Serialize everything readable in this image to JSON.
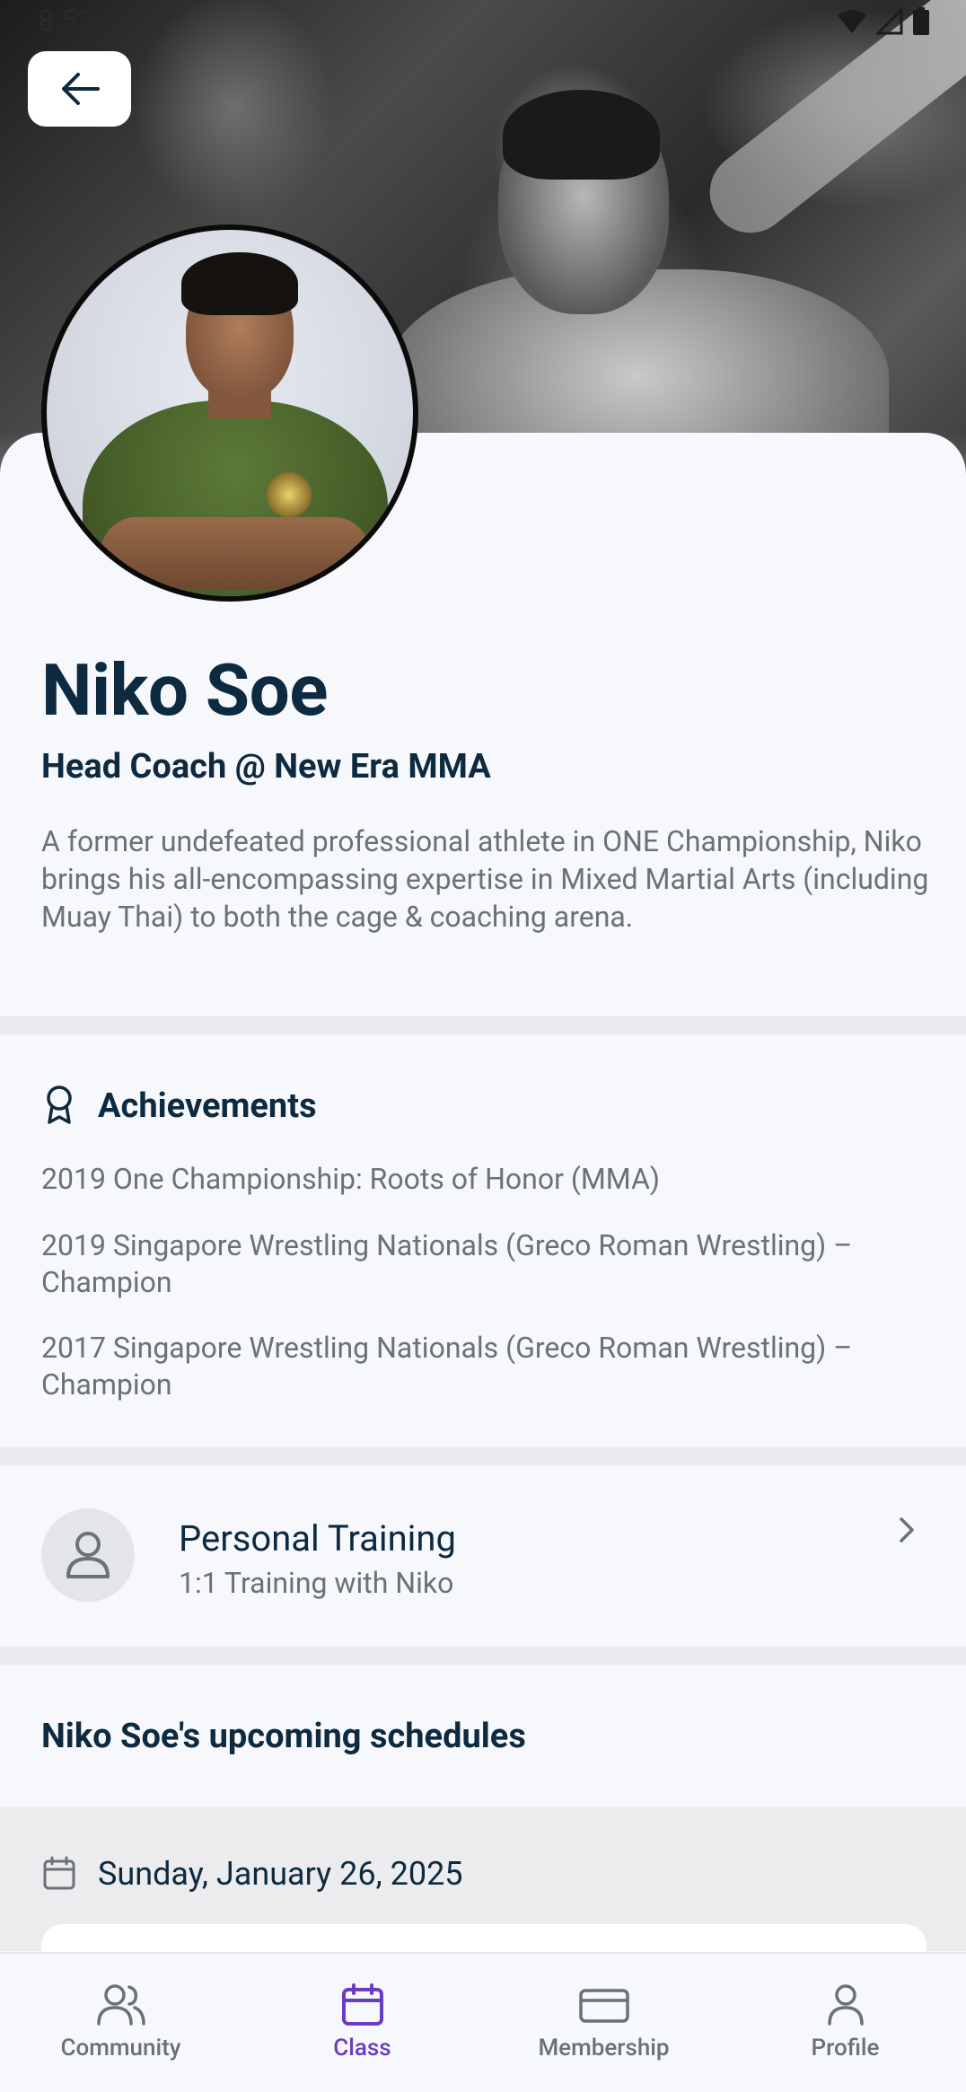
{
  "status_bar": {
    "time": "8:52"
  },
  "coach": {
    "name": "Niko Soe",
    "title": "Head Coach @ New Era MMA",
    "bio": "A former undefeated professional athlete in ONE Championship, Niko brings his all-encompassing expertise in Mixed Martial Arts (including Muay Thai) to both the cage & coaching arena."
  },
  "achievements": {
    "heading": "Achievements",
    "items": [
      "2019 One Championship: Roots of Honor (MMA)",
      "2019 Singapore Wrestling Nationals (Greco Roman Wrestling) – Champion",
      "2017 Singapore Wrestling Nationals (Greco Roman Wrestling) – Champion"
    ]
  },
  "personal_training": {
    "title": "Personal Training",
    "subtitle": "1:1 Training with Niko"
  },
  "schedule": {
    "heading": "Niko Soe's upcoming schedules",
    "date": "Sunday, January 26, 2025"
  },
  "nav": {
    "items": [
      {
        "label": "Community",
        "icon": "users-icon"
      },
      {
        "label": "Class",
        "icon": "calendar-icon"
      },
      {
        "label": "Membership",
        "icon": "card-icon"
      },
      {
        "label": "Profile",
        "icon": "user-icon"
      }
    ],
    "active": "Class"
  },
  "colors": {
    "primary_text": "#0d2a40",
    "secondary_text": "#6b7178",
    "accent": "#6a3cc4",
    "background": "#f7f8fc"
  }
}
